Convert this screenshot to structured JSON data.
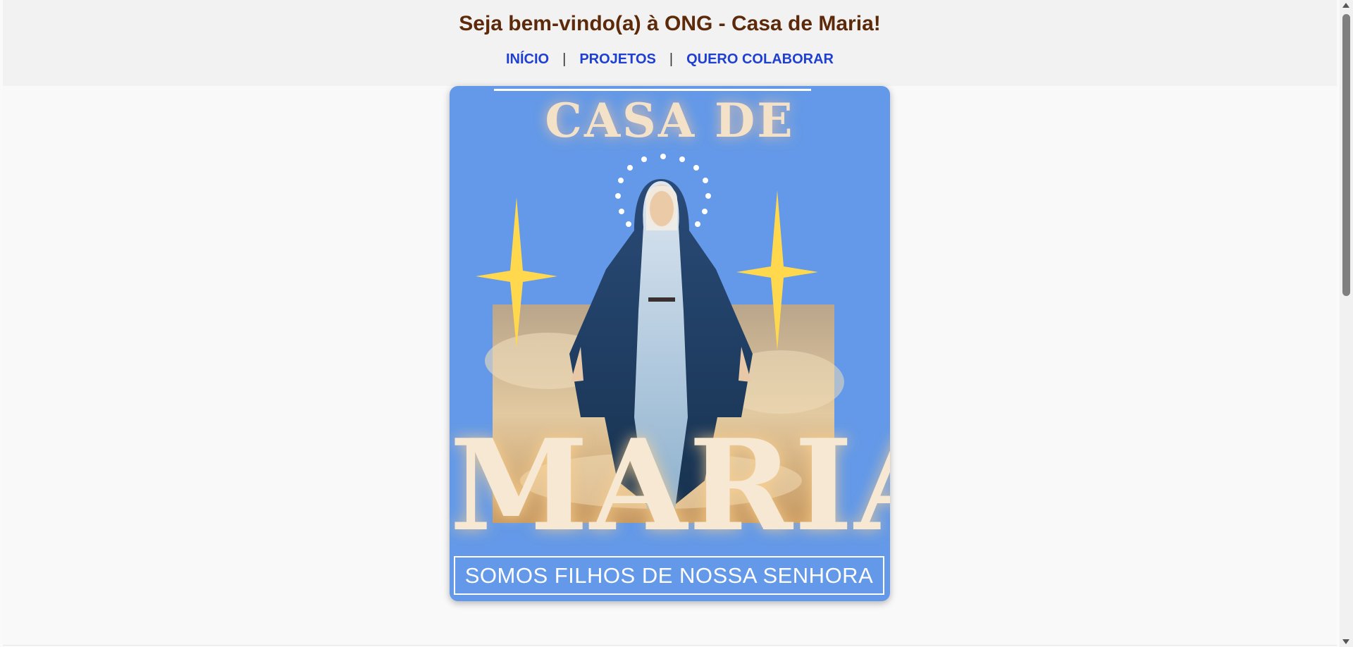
{
  "header": {
    "title": "Seja bem-vindo(a) à ONG - Casa de Maria!",
    "nav": [
      {
        "label": "INÍCIO"
      },
      {
        "label": "PROJETOS"
      },
      {
        "label": "QUERO COLABORAR"
      }
    ],
    "separator": "|"
  },
  "poster": {
    "title_top": "CASA DE",
    "title_main": "MARIA",
    "tagline": "SOMOS FILHOS DE NOSSA SENHORA",
    "colors": {
      "background": "#6399e8",
      "stars": "#ffd84d",
      "title": "#f6e8d2"
    },
    "illustration": "virgin-mary-figure"
  },
  "colors": {
    "title": "#5c2a0a",
    "nav_link": "#1f3fd1"
  }
}
